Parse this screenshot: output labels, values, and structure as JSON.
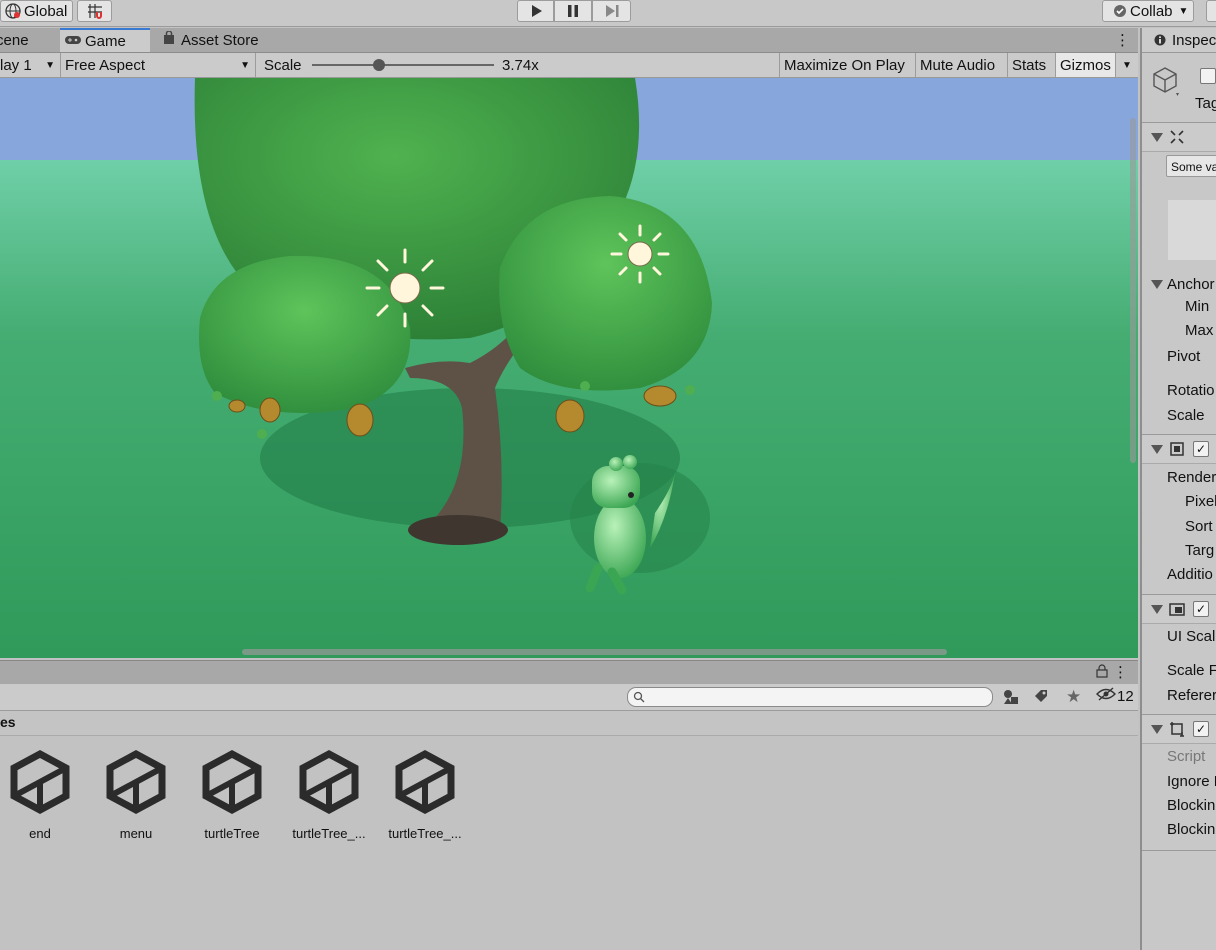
{
  "toolbar": {
    "global_label": "Global",
    "collab_label": "Collab"
  },
  "game_panel": {
    "tabs": [
      {
        "label": "Scene"
      },
      {
        "label": "Game"
      },
      {
        "label": "Asset Store"
      }
    ],
    "display_label": "lay 1",
    "aspect_label": "Free Aspect",
    "scale_label": "Scale",
    "scale_value": "3.74x",
    "scale_slider_fraction": 0.37,
    "maximize_label": "Maximize On Play",
    "mute_label": "Mute Audio",
    "stats_label": "Stats",
    "gizmos_label": "Gizmos"
  },
  "project_panel": {
    "hidden_count": "12",
    "breadcrumb": "es",
    "assets": [
      {
        "name": "end"
      },
      {
        "name": "menu"
      },
      {
        "name": "turtleTree"
      },
      {
        "name": "turtleTree_..."
      },
      {
        "name": "turtleTree_..."
      }
    ]
  },
  "inspector": {
    "tab_label": "Inspec",
    "tag_label": "Tag",
    "dropdown_value": "Some va",
    "rect": {
      "anchors": "Anchor",
      "min": "Min",
      "max": "Max",
      "pivot": "Pivot",
      "rotation": "Rotatio",
      "scale": "Scale"
    },
    "canvas": {
      "render": "Render",
      "pixel": "Pixel",
      "sort": "Sort",
      "target": "Targ",
      "additional": "Additio"
    },
    "scaler": {
      "ui_scale": "UI Scal",
      "scale_f": "Scale F",
      "reference": "Referer"
    },
    "raycaster": {
      "script": "Script",
      "ignore": "Ignore R",
      "blocking1": "Blockin",
      "blocking2": "Blockin"
    }
  },
  "colors": {
    "sky": "#86a6dc",
    "ground": "#2f9a5a",
    "tab_accent": "#3a79d1"
  }
}
